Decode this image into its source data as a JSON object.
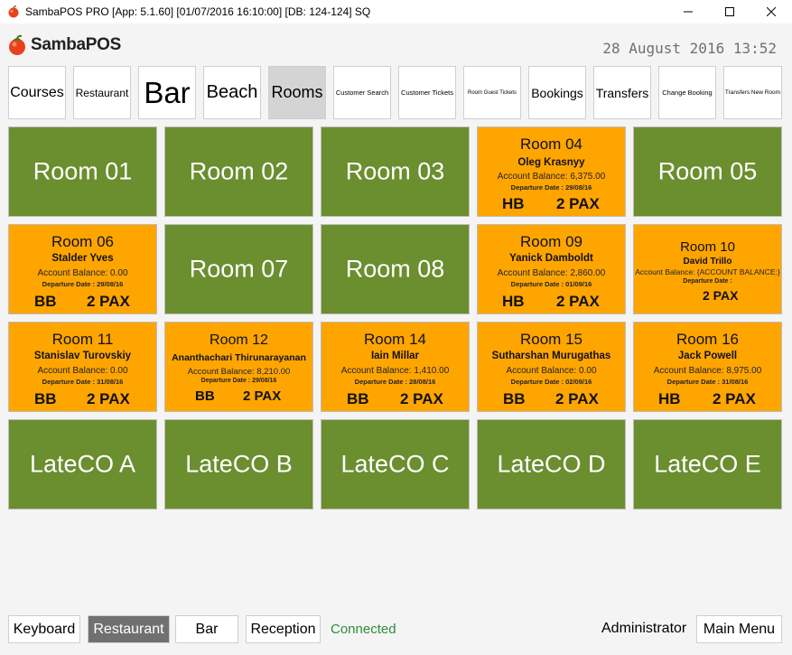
{
  "window": {
    "title": "SambaPOS PRO [App: 5.1.60] [01/07/2016 16:10:00] [DB: 124-124] SQ"
  },
  "header": {
    "logo_text": "SambaPOS",
    "datetime": "28 August 2016 13:52"
  },
  "categories": [
    "Courses",
    "Restaurant",
    "Bar",
    "Beach",
    "Rooms",
    "Customer Search",
    "Customer Tickets",
    "Room Guest Tickets",
    "Bookings",
    "Transfers",
    "Change Booking",
    "Transfers New Room"
  ],
  "selected_category": "Rooms",
  "rooms": [
    {
      "name": "Room 01",
      "status": "vacant"
    },
    {
      "name": "Room 02",
      "status": "vacant"
    },
    {
      "name": "Room 03",
      "status": "vacant"
    },
    {
      "name": "Room 04",
      "status": "occupied",
      "guest": "Oleg Krasnyy",
      "balance": "Account Balance: 6,375.00",
      "departure": "Departure Date : 29/08/16",
      "board": "HB",
      "pax": "2 PAX"
    },
    {
      "name": "Room 05",
      "status": "vacant"
    },
    {
      "name": "Room 06",
      "status": "occupied",
      "guest": "Stalder Yves",
      "balance": "Account Balance: 0.00",
      "departure": "Departure Date : 29/08/16",
      "board": "BB",
      "pax": "2 PAX"
    },
    {
      "name": "Room 07",
      "status": "vacant"
    },
    {
      "name": "Room 08",
      "status": "vacant"
    },
    {
      "name": "Room 09",
      "status": "occupied",
      "guest": "Yanick Damboldt",
      "balance": "Account Balance: 2,860.00",
      "departure": "Departure Date : 01/09/16",
      "board": "HB",
      "pax": "2 PAX"
    },
    {
      "name": "Room 10",
      "status": "occupied",
      "guest": "David Trillo",
      "balance": "Account Balance: {ACCOUNT BALANCE:}",
      "departure": "Departure Date :",
      "board": "",
      "pax": "2 PAX"
    },
    {
      "name": "Room 11",
      "status": "occupied",
      "guest": "Stanislav Turovskiy",
      "balance": "Account Balance: 0.00",
      "departure": "Departure Date : 31/08/16",
      "board": "BB",
      "pax": "2 PAX"
    },
    {
      "name": "Room 12",
      "status": "occupied",
      "guest": "Ananthachari Thirunarayanan",
      "balance": "Account Balance: 8,210.00",
      "departure": "Departure Date : 29/08/16",
      "board": "BB",
      "pax": "2 PAX"
    },
    {
      "name": "Room 14",
      "status": "occupied",
      "guest": "Iain Millar",
      "balance": "Account Balance: 1,410.00",
      "departure": "Departure Date : 28/08/16",
      "board": "BB",
      "pax": "2 PAX"
    },
    {
      "name": "Room 15",
      "status": "occupied",
      "guest": "Sutharshan Murugathas",
      "balance": "Account Balance: 0.00",
      "departure": "Departure Date : 02/09/16",
      "board": "BB",
      "pax": "2 PAX"
    },
    {
      "name": "Room 16",
      "status": "occupied",
      "guest": "Jack Powell",
      "balance": "Account Balance: 8,975.00",
      "departure": "Departure Date : 31/08/16",
      "board": "HB",
      "pax": "2 PAX"
    },
    {
      "name": "LateCO A",
      "status": "vacant"
    },
    {
      "name": "LateCO B",
      "status": "vacant"
    },
    {
      "name": "LateCO C",
      "status": "vacant"
    },
    {
      "name": "LateCO D",
      "status": "vacant"
    },
    {
      "name": "LateCO E",
      "status": "vacant"
    }
  ],
  "bottom": {
    "buttons": [
      "Keyboard",
      "Restaurant",
      "Bar",
      "Reception"
    ],
    "active_button": "Restaurant",
    "status": "Connected",
    "user": "Administrator",
    "main_menu": "Main Menu"
  },
  "colors": {
    "vacant": "#6b8e2f",
    "occupied": "#ffa500",
    "connected": "#2e8b3a"
  }
}
